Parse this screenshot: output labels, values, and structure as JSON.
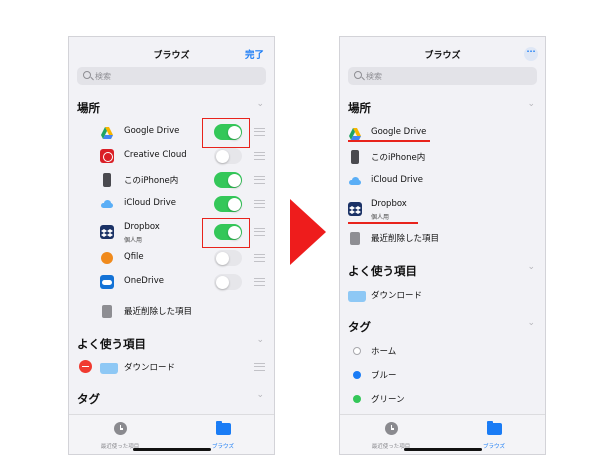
{
  "left": {
    "nav": {
      "title": "ブラウズ",
      "done": "完了"
    },
    "search_placeholder": "検索",
    "sections": {
      "locations": "場所",
      "favorites": "よく使う項目",
      "tags": "タグ"
    },
    "locations": [
      {
        "label": "Google Drive",
        "enabled": true
      },
      {
        "label": "Creative Cloud",
        "enabled": false
      },
      {
        "label": "このiPhone内",
        "enabled": true
      },
      {
        "label": "iCloud Drive",
        "enabled": true
      },
      {
        "label": "Dropbox",
        "sublabel": "個人用",
        "enabled": true
      },
      {
        "label": "Qfile",
        "enabled": false
      },
      {
        "label": "OneDrive",
        "enabled": false
      },
      {
        "label": "最近削除した項目"
      }
    ],
    "favorites": [
      {
        "label": "ダウンロード"
      }
    ],
    "tabs": {
      "recents": "最近使った項目",
      "browse": "ブラウズ"
    }
  },
  "right": {
    "nav": {
      "title": "ブラウズ",
      "more": "···"
    },
    "search_placeholder": "検索",
    "sections": {
      "locations": "場所",
      "favorites": "よく使う項目",
      "tags": "タグ"
    },
    "locations": [
      {
        "label": "Google Drive"
      },
      {
        "label": "このiPhone内"
      },
      {
        "label": "iCloud Drive"
      },
      {
        "label": "Dropbox",
        "sublabel": "個人用"
      },
      {
        "label": "最近削除した項目"
      }
    ],
    "favorites": [
      {
        "label": "ダウンロード"
      }
    ],
    "tags": [
      {
        "label": "ホーム",
        "color": "#ffffff"
      },
      {
        "label": "ブルー",
        "color": "#1a7cf5"
      },
      {
        "label": "グリーン",
        "color": "#34c759"
      }
    ],
    "tabs": {
      "recents": "最近使った項目",
      "browse": "ブラウズ"
    }
  },
  "colors": {
    "accent": "#1a7cf5",
    "toggle_on": "#34c759",
    "highlight": "#e8231c"
  }
}
